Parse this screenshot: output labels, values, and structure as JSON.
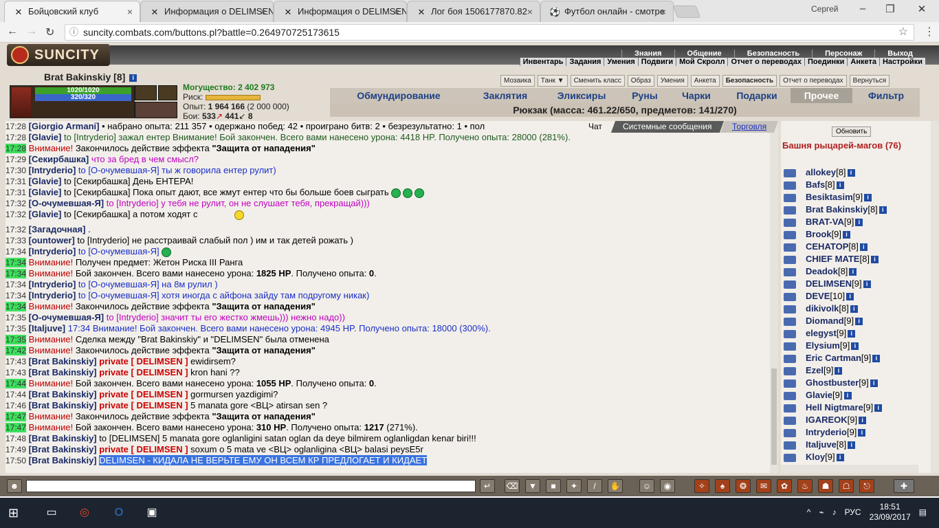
{
  "browser": {
    "tabs": [
      {
        "title": "Бойцовский клуб",
        "icon": "sword-icon",
        "active": true
      },
      {
        "title": "Информация о DELIMSEN",
        "icon": "sword-icon"
      },
      {
        "title": "Информация о DELIMSEN",
        "icon": "sword-icon"
      },
      {
        "title": "Лог боя 1506177870.82",
        "icon": "sword-icon"
      },
      {
        "title": "Футбол онлайн - смотре",
        "icon": "football-icon"
      }
    ],
    "profile": "Сергей",
    "url": "suncity.combats.com/buttons.pl?battle=0.264970725173615"
  },
  "game": {
    "logo": "SUNCITY",
    "top_links": [
      "Знания",
      "Общение",
      "Безопасность",
      "Персонаж",
      "Выход"
    ],
    "sub_links": [
      "Инвентарь",
      "Задания",
      "Умения",
      "Подвиги",
      "Мой Скролл",
      "Отчет о переводах",
      "Поединки",
      "Анкета",
      "Настройки"
    ],
    "character": {
      "name": "Brat Bakinskiy",
      "level": "[8]",
      "hp": "1020/1020",
      "mp": "320/320",
      "power_label": "Могущество:",
      "power_value": "2 402 973",
      "risk_label": "Риск:",
      "exp_label": "Опыт:",
      "exp_value": "1 964 166",
      "exp_next": "(2 000 000)",
      "fights_label": "Бои:",
      "wins": "533",
      "losses": "441",
      "draws": "8"
    },
    "action_buttons": [
      "Мозаика",
      "Танк ▼",
      "Сменить класс",
      "Образ",
      "Умения",
      "Анкета",
      "Безопасность",
      "Отчет о переводах",
      "Вернуться"
    ],
    "inventory_tabs": [
      "Обмундирование",
      "Заклятия",
      "Эликсиры",
      "Руны",
      "Чарки",
      "Подарки",
      "Прочее",
      "Фильтр"
    ],
    "selected_tab": "Прочее",
    "backpack": "Рюкзак (масса: 461.22/650, предметов: 141/270)",
    "chat_tabs": [
      "Чат",
      "Системные сообщения",
      "Торговля"
    ],
    "chat": [
      {
        "time": "17:28",
        "nick": "[Giorgio Armani]",
        "text": " • набрано опыта: 211 357 • одержано побед: 42 • проиграно битв: 2 • безрезультатно: 1 • пол"
      },
      {
        "time": "17:28",
        "nick": "[Glavie]",
        "text": " to [Intryderio] зажал ентер Внимание! Бой закончен. Всего вами нанесено урона: 4418 HP. Получено опыта: 28000 (281%).",
        "color": "green"
      },
      {
        "time": "17:28",
        "hl": true,
        "warn": "Внимание!",
        "text": " Закончилось действие эффекта ",
        "bold": "\"Защита от нападения\""
      },
      {
        "time": "17:29",
        "nick": "[Секирбашка]",
        "text": " что за бред в чем смысл?",
        "color": "purple"
      },
      {
        "time": "17:30",
        "nick": "[Intryderio]",
        "text": " to [О-очумевшая-Я] ты ж говорила ентер рулит)",
        "color": "blue"
      },
      {
        "time": "17:31",
        "nick": "[Glavie]",
        "text": " to [Секирбашка] День ЕНТЕРА!"
      },
      {
        "time": "17:31",
        "nick": "[Glavie]",
        "text": " to [Секирбашка] Пока опыт дают, все жмут ентер что бы больше боев сыграть",
        "smiles": 3
      },
      {
        "time": "17:32",
        "nick": "[О-очумевшая-Я]",
        "text": " to [Intryderio] у тебя не рулит, он не слушает тебя, прекращай)))",
        "color": "purple"
      },
      {
        "time": "17:32",
        "nick": "[Glavie]",
        "text": " to [Секирбашка] а потом ходят с",
        "gap": true
      },
      {
        "time": "17:32",
        "nick": "[Загадочная]",
        "text": " ."
      },
      {
        "time": "17:33",
        "nick": "[ountower]",
        "text": " to [Intryderio] не расстраивай слабый пол ) им и так детей рожать )"
      },
      {
        "time": "17:34",
        "nick": "[Intryderio]",
        "text": " to [О-очумевшая-Я]",
        "color": "blue",
        "smiles": 1
      },
      {
        "time": "17:34",
        "hl": true,
        "warn": "Внимание!",
        "text": " Получен предмет: Жетон Риска III Ранга"
      },
      {
        "time": "17:34",
        "hl": true,
        "warn": "Внимание!",
        "text": " Бой закончен. Всего вами нанесено урона: ",
        "bold": "1825 HP",
        "text2": ". Получено опыта: ",
        "bold2": "0",
        "text3": "."
      },
      {
        "time": "17:34",
        "nick": "[Intryderio]",
        "text": " to [О-очумевшая-Я] на 8м рулил )",
        "color": "blue"
      },
      {
        "time": "17:34",
        "nick": "[Intryderio]",
        "text": " to [О-очумевшая-Я] хотя иногда с айфона зайду там подругому никак)",
        "color": "blue"
      },
      {
        "time": "17:34",
        "hl": true,
        "warn": "Внимание!",
        "text": " Закончилось действие эффекта ",
        "bold": "\"Защита от нападения\""
      },
      {
        "time": "17:35",
        "nick": "[О-очумевшая-Я]",
        "text": " to [Intryderio] значит ты его жестко жмешь))) нежно надо))",
        "color": "purple"
      },
      {
        "time": "17:35",
        "nick": "[Italjuve]",
        "text": " 17:34 Внимание! Бой закончен. Всего вами нанесено урона: 4945 HP. Получено опыта: 18000 (300%).",
        "color": "blue"
      },
      {
        "time": "17:35",
        "hl": true,
        "warn": "Внимание!",
        "text": " Сделка между \"Brat Bakinskiy\" и \"DELIMSEN\" была отменена"
      },
      {
        "time": "17:42",
        "hl": true,
        "warn": "Внимание!",
        "text": " Закончилось действие эффекта ",
        "bold": "\"Защита от нападения\""
      },
      {
        "time": "17:43",
        "nick": "[Brat Bakinskiy]",
        "priv": "private [ DELIMSEN ]",
        "text": " ewidirsem?"
      },
      {
        "time": "17:43",
        "nick": "[Brat Bakinskiy]",
        "priv": "private [ DELIMSEN ]",
        "text": " kron hani ??"
      },
      {
        "time": "17:44",
        "hl": true,
        "warn": "Внимание!",
        "text": " Бой закончен. Всего вами нанесено урона: ",
        "bold": "1055 HP",
        "text2": ". Получено опыта: ",
        "bold2": "0",
        "text3": "."
      },
      {
        "time": "17:44",
        "nick": "[Brat Bakinskiy]",
        "priv": "private [ DELIMSEN ]",
        "text": " gormursen yazdigimi?"
      },
      {
        "time": "17:46",
        "nick": "[Brat Bakinskiy]",
        "priv": "private [ DELIMSEN ]",
        "text": " 5 manata gore <ВЦ> atirsan sen ?"
      },
      {
        "time": "17:47",
        "hl": true,
        "warn": "Внимание!",
        "text": " Закончилось действие эффекта ",
        "bold": "\"Защита от нападения\""
      },
      {
        "time": "17:47",
        "hl": true,
        "warn": "Внимание!",
        "text": " Бой закончен. Всего вами нанесено урона: ",
        "bold": "310 HP",
        "text2": ". Получено опыта: ",
        "bold2": "1217",
        "text3": " (271%)."
      },
      {
        "time": "17:48",
        "nick": "[Brat Bakinskiy]",
        "text": " to [DELIMSEN] 5 manata gore oglanligini satan oglan da deye bilmirem oglanligdan kenar biri!!!"
      },
      {
        "time": "17:49",
        "nick": "[Brat Bakinskiy]",
        "priv": "private [ DELIMSEN ]",
        "text": " soxum o 5 mata ve <ВЦ> oglanligina <ВЦ> balasi peysE5r"
      },
      {
        "time": "17:50",
        "nick": "[Brat Bakinskiy]",
        "selected": "DELIMSEN - КИДАЛА НЕ ВЕРЬТЕ ЕМУ ОН ВСЕМ КР ПРЕДЛОГАЕТ И КИДАЕТ"
      }
    ],
    "refresh": "Обновить",
    "room": "Башня рыцарей-магов (76)",
    "players": [
      {
        "name": "allokey",
        "lvl": "[8]"
      },
      {
        "name": "Bafs",
        "lvl": "[8]"
      },
      {
        "name": "Besiktasim",
        "lvl": "[9]"
      },
      {
        "name": "Brat Bakinskiy",
        "lvl": "[8]"
      },
      {
        "name": "BRAT-VA",
        "lvl": "[9]"
      },
      {
        "name": "Brook",
        "lvl": "[9]"
      },
      {
        "name": "CEHATOP",
        "lvl": "[8]"
      },
      {
        "name": "CHIEF MATE",
        "lvl": "[8]"
      },
      {
        "name": "Deadok",
        "lvl": "[8]"
      },
      {
        "name": "DELIMSEN",
        "lvl": "[9]"
      },
      {
        "name": "DEVE",
        "lvl": "[10]"
      },
      {
        "name": "dikivolk",
        "lvl": "[8]"
      },
      {
        "name": "Diomand",
        "lvl": "[9]"
      },
      {
        "name": "elegyst",
        "lvl": "[9]"
      },
      {
        "name": "Elysium",
        "lvl": "[9]"
      },
      {
        "name": "Eric Cartman",
        "lvl": "[9]"
      },
      {
        "name": "Ezel",
        "lvl": "[9]"
      },
      {
        "name": "Ghostbuster",
        "lvl": "[9]"
      },
      {
        "name": "Glavie",
        "lvl": "[9]"
      },
      {
        "name": "Hell Nigtmare",
        "lvl": "[9]"
      },
      {
        "name": "IGAREOK",
        "lvl": "[9]"
      },
      {
        "name": "Intryderio",
        "lvl": "[9]"
      },
      {
        "name": "Italjuve",
        "lvl": "[8]"
      },
      {
        "name": "Kloy",
        "lvl": "[9]"
      }
    ]
  },
  "taskbar": {
    "lang": "РУС",
    "time": "18:51",
    "date": "23/09/2017"
  },
  "colors": {
    "accent": "#1c3f85",
    "warn": "#c20000",
    "highlight": "#3de05d"
  }
}
